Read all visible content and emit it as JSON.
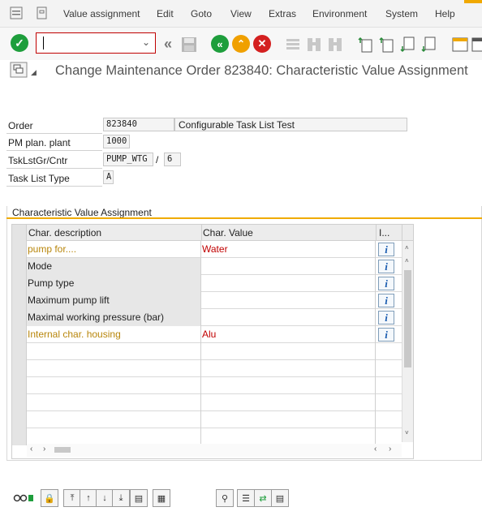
{
  "menu": {
    "items": [
      "Value assignment",
      "Edit",
      "Goto",
      "View",
      "Extras",
      "Environment",
      "System",
      "Help"
    ]
  },
  "toolbar": {
    "command_field_value": "",
    "icons": [
      "enter-icon",
      "back-icon",
      "exit-icon",
      "cancel-icon",
      "save-icon"
    ]
  },
  "title": "Change Maintenance Order 823840: Characteristic Value Assignment",
  "header": {
    "order_label": "Order",
    "order_value": "823840",
    "order_desc": "Configurable Task List Test",
    "plant_label": "PM plan. plant",
    "plant_value": "1000",
    "tasklist_label": "TskLstGr/Cntr",
    "tasklist_group": "PUMP_WTG",
    "tasklist_sep": "/",
    "tasklist_counter": "6",
    "type_label": "Task List Type",
    "type_value": "A"
  },
  "group_title": "Characteristic Value Assignment",
  "table": {
    "columns": [
      "Char. description",
      "Char. Value",
      "I..."
    ],
    "rows": [
      {
        "description": "pump for....",
        "value": "Water",
        "info": "i",
        "desc_color": "#b8860b",
        "value_color": "#c00000",
        "gray": false
      },
      {
        "description": "Mode",
        "value": "",
        "info": "i",
        "desc_color": "#222222",
        "value_color": "#222222",
        "gray": true
      },
      {
        "description": "Pump type",
        "value": "",
        "info": "i",
        "desc_color": "#222222",
        "value_color": "#222222",
        "gray": true
      },
      {
        "description": "Maximum pump lift",
        "value": "",
        "info": "i",
        "desc_color": "#222222",
        "value_color": "#222222",
        "gray": true
      },
      {
        "description": "Maximal working pressure (bar)",
        "value": "",
        "info": "i",
        "desc_color": "#222222",
        "value_color": "#222222",
        "gray": true
      },
      {
        "description": "Internal char. housing",
        "value": "Alu",
        "info": "i",
        "desc_color": "#b8860b",
        "value_color": "#c00000",
        "gray": false
      }
    ],
    "empty_rows": 6
  },
  "colors": {
    "accent": "#f0ab00",
    "enter_green": "#1e9e3c",
    "back_green": "#1e9e3c",
    "exit_orange": "#f0a000",
    "cancel_red": "#d42020",
    "info_blue": "#1a5cb0"
  }
}
